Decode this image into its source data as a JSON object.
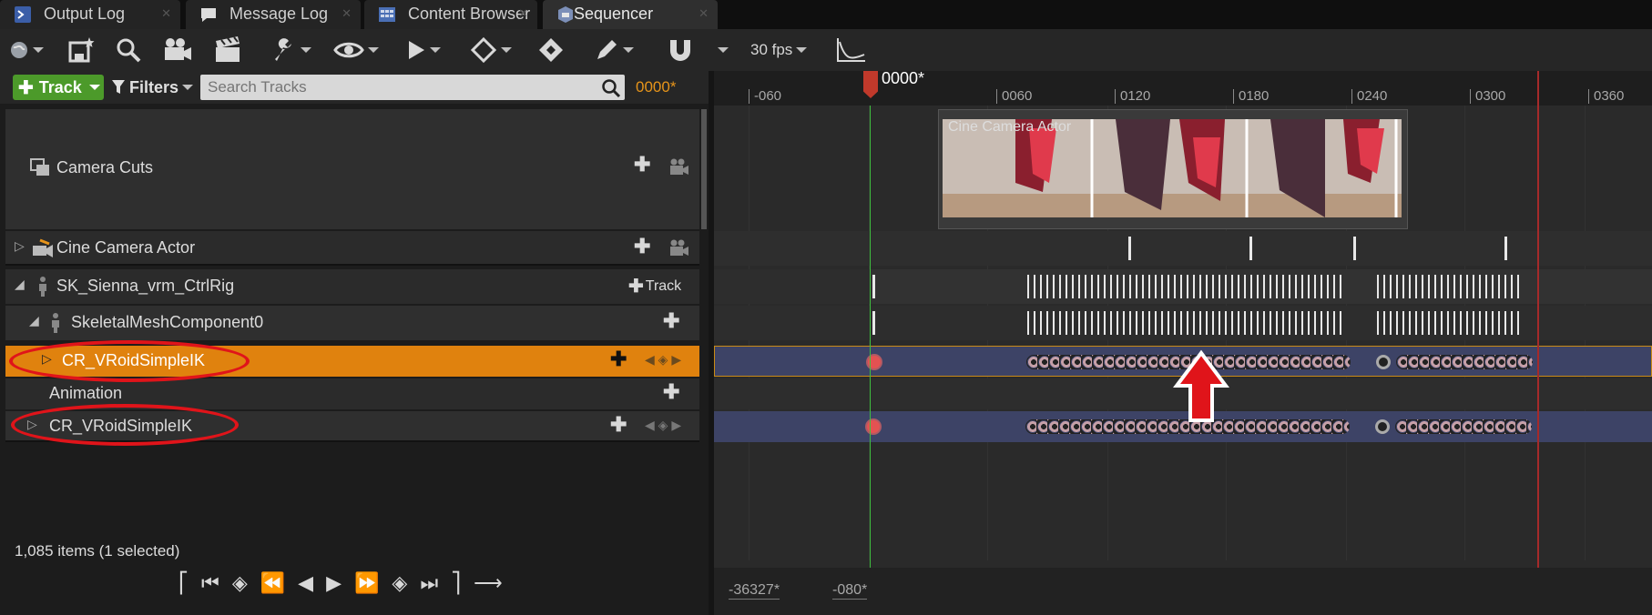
{
  "tabs": [
    {
      "label": "Output Log",
      "icon": "output-log-icon"
    },
    {
      "label": "Message Log",
      "icon": "message-log-icon"
    },
    {
      "label": "Content Browser",
      "icon": "content-browser-icon"
    },
    {
      "label": "Sequencer",
      "icon": "sequencer-icon",
      "active": true
    }
  ],
  "toolbar": {
    "fps": "30 fps"
  },
  "filterbar": {
    "track_label": "Track",
    "filters_label": "Filters",
    "search_placeholder": "Search Tracks",
    "current_time": "0000*"
  },
  "tracks": {
    "camera_cuts": "Camera Cuts",
    "cine_camera_actor": "Cine Camera Actor",
    "ctrl_rig": "SK_Sienna_vrm_CtrlRig",
    "ctrl_rig_track_btn": "Track",
    "skeletal_mesh": "SkeletalMeshComponent0",
    "cr_selected": "CR_VRoidSimpleIK",
    "animation": "Animation",
    "cr_second": "CR_VRoidSimpleIK"
  },
  "status": {
    "items": "1,085 items (1 selected)"
  },
  "timeline": {
    "playhead_label": "0000*",
    "ruler_ticks": [
      "-060",
      "0060",
      "0120",
      "0180",
      "0240",
      "0300",
      "0360"
    ],
    "camera_section_label": "Cine Camera Actor",
    "range_start": "-36327*",
    "range_end": "-080*"
  },
  "colors": {
    "selected_row": "#e0820e",
    "track_add_green": "#4c9a2a",
    "playhead": "#c0392b",
    "annotation_red": "#e0141a"
  }
}
